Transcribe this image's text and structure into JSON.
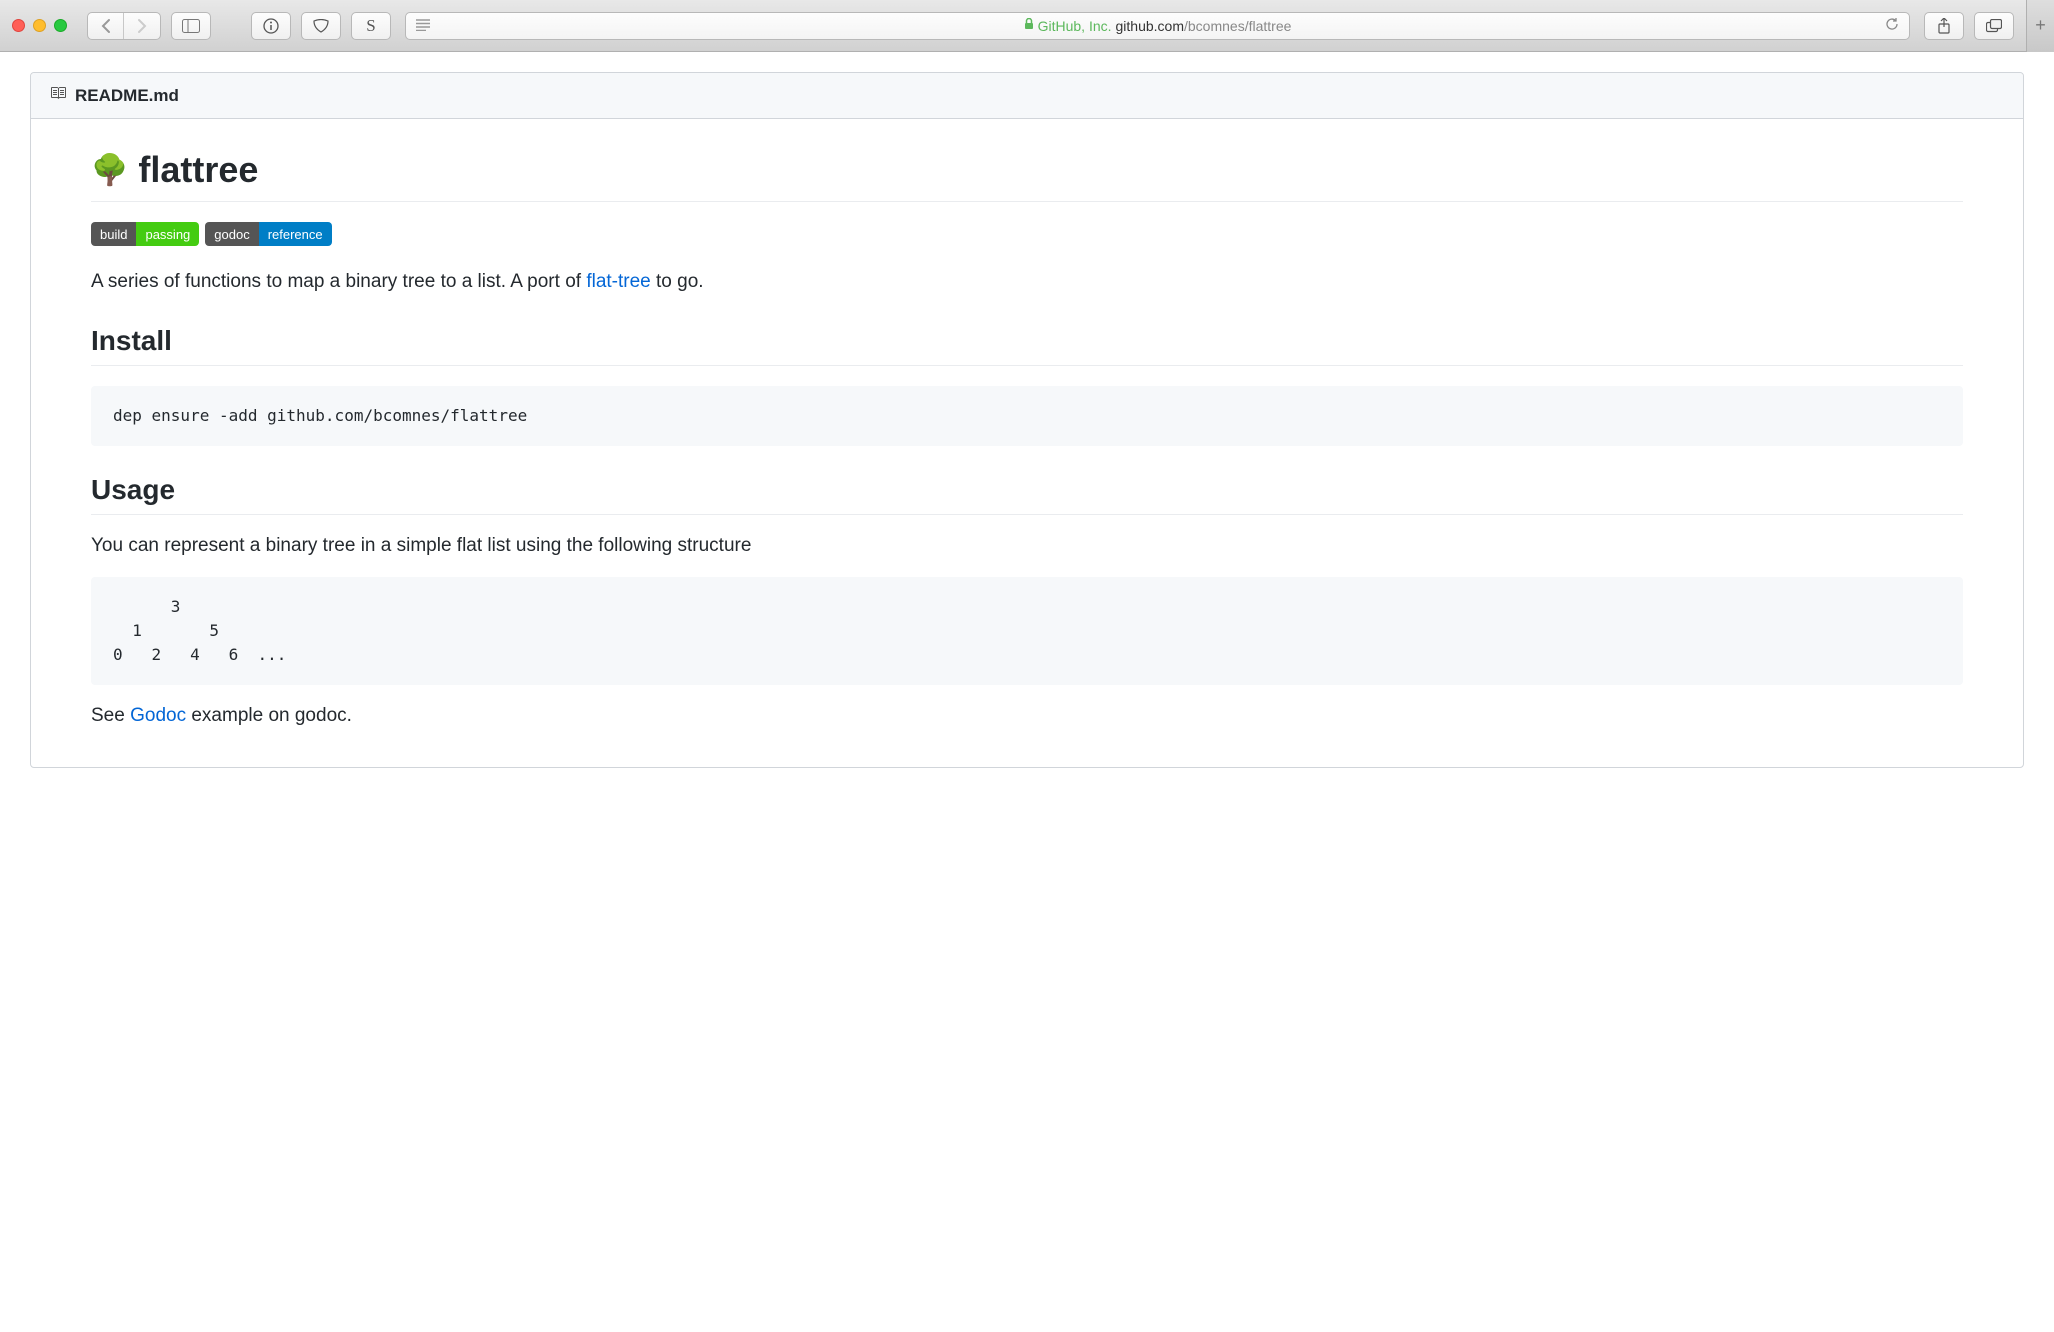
{
  "toolbar": {
    "url_owner": "GitHub, Inc.",
    "url_domain": "github.com",
    "url_path": "/bcomnes/flattree",
    "s_label": "S"
  },
  "readme": {
    "filename": "README.md",
    "title_emoji": "🌳",
    "title": "flattree",
    "badges": {
      "build_label": "build",
      "build_value": "passing",
      "godoc_label": "godoc",
      "godoc_value": "reference"
    },
    "description_pre": "A series of functions to map a binary tree to a list. A port of ",
    "description_link": "flat-tree",
    "description_post": " to go.",
    "install_heading": "Install",
    "install_code": "dep ensure -add github.com/bcomnes/flattree",
    "usage_heading": "Usage",
    "usage_text": "You can represent a binary tree in a simple flat list using the following structure",
    "usage_code": "      3\n  1       5\n0   2   4   6  ...",
    "godoc_pre": "See ",
    "godoc_link": "Godoc",
    "godoc_post": " example on godoc."
  }
}
